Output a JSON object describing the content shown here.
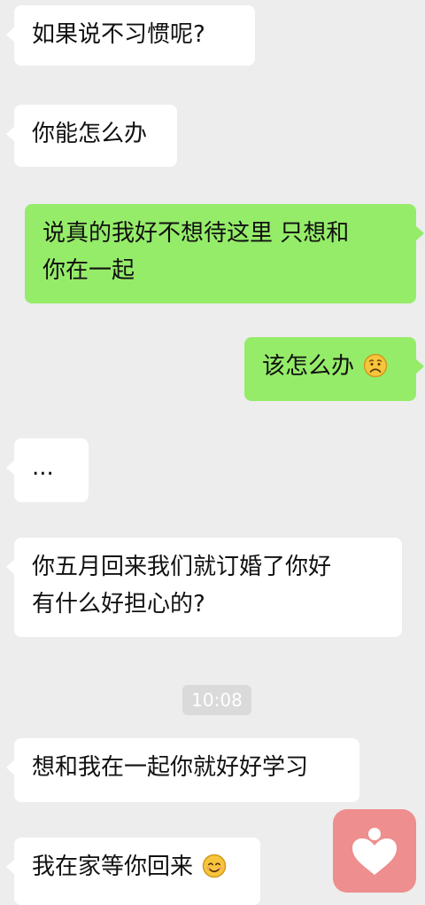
{
  "chat": {
    "messages": [
      {
        "from": "contact",
        "text": "如果说不习惯呢?"
      },
      {
        "from": "contact",
        "text": "你能怎么办"
      },
      {
        "from": "me",
        "lines": [
          "说真的我好不想待这里 只想和",
          "你在一起"
        ]
      },
      {
        "from": "me",
        "text": "该怎么办",
        "emoji": "frowning-face-icon"
      },
      {
        "from": "contact",
        "text": "..."
      },
      {
        "from": "contact",
        "lines": [
          "你五月回来我们就订婚了你好",
          "有什么好担心的?"
        ]
      },
      {
        "from": "contact",
        "text": "想和我在一起你就好好学习"
      },
      {
        "from": "contact",
        "text": "我在家等你回来",
        "emoji": "smiling-face-icon"
      }
    ],
    "timestamp": "10:08"
  },
  "colors": {
    "background": "#ededed",
    "incoming_bubble": "#ffffff",
    "outgoing_bubble": "#95ec69",
    "timestamp_badge": "#dadada",
    "floating_button": "#ee8e8e"
  },
  "floating_button": {
    "icon": "heart-person-icon"
  }
}
